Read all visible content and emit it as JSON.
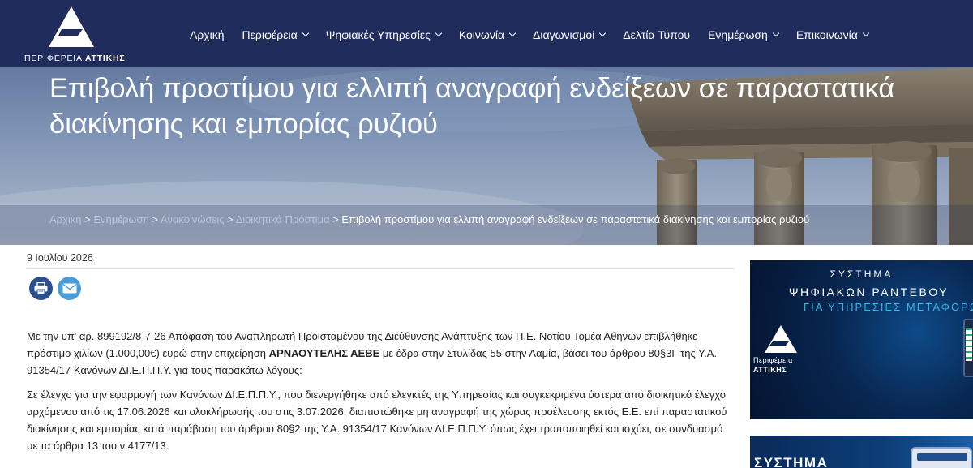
{
  "brand": {
    "logo_text_prefix": "ΠΕΡΙΦΕΡΕΙΑ ",
    "logo_text_bold": "ΑΤΤΙΚΗΣ"
  },
  "nav": {
    "items": [
      {
        "label": "Αρχική",
        "has_dropdown": false
      },
      {
        "label": "Περιφέρεια",
        "has_dropdown": true
      },
      {
        "label": "Ψηφιακές Υπηρεσίες",
        "has_dropdown": true
      },
      {
        "label": "Κοινωνία",
        "has_dropdown": true
      },
      {
        "label": "Διαγωνισμοί",
        "has_dropdown": true
      },
      {
        "label": "Δελτία Τύπου",
        "has_dropdown": false
      },
      {
        "label": "Ενημέρωση",
        "has_dropdown": true
      },
      {
        "label": "Επικοινωνία",
        "has_dropdown": true
      }
    ]
  },
  "hero": {
    "title": "Επιβολή προστίμου για ελλιπή αναγραφή ενδείξεων σε παραστατικά διακίνησης και εμπορίας ρυζιού"
  },
  "breadcrumb": {
    "home": "Αρχική",
    "news": "Ενημέρωση",
    "announcements": "Ανακοινώσεις",
    "fines": "Διοικητικά Πρόστιμα",
    "separator": " > ",
    "current": "Επιβολή προστίμου για ελλιπή αναγραφή ενδείξεων σε παραστατικά διακίνησης και εμπορίας ρυζιού"
  },
  "article": {
    "date": "9 Ιουλίου 2026",
    "p1_before": "Με την υπ' αρ. 899192/8-7-26 Απόφαση του Αναπληρωτή Προϊσταμένου της Διεύθυνσης Ανάπτυξης των Π.Ε. Νοτίου Τομέα Αθηνών επιβλήθηκε πρόστιμο χιλίων (1.000,00€) ευρώ στην επιχείρηση ",
    "p1_bold": "ΑΡΝΑΟΥΤΕΛΗΣ ΑΕΒΕ",
    "p1_after": " με έδρα στην Στυλίδας 55 στην Λαμία, βάσει του άρθρου 80§3Γ της Υ.Α. 91354/17 Κανόνων ΔΙ.Ε.Π.Π.Υ. για τους παρακάτω λόγους:",
    "p2": "Σε έλεγχο για την εφαρμογή των Κανόνων ΔΙ.Ε.Π.Π.Υ., που διενεργήθηκε από ελεγκτές της Υπηρεσίας και συγκεκριμένα ύστερα από διοικητικό έλεγχο αρχόμενου από τις 17.06.2026 και ολοκλήρωσής του στις 3.07.2026, διαπιστώθηκε μη αναγραφή της χώρας προέλευσης εκτός Ε.Ε. επί παραστατικού διακίνησης και εμπορίας κατά παράβαση του άρθρου 80§2 της Υ.Α. 91354/17 Κανόνων ΔΙ.Ε.Π.Π.Υ. όπως έχει τροποποιηθεί και ισχύει, σε συνδυασμό με τα άρθρα 13 του ν.4177/13."
  },
  "share": {
    "print_icon": "print-icon",
    "email_icon": "email-icon"
  },
  "sidebar": {
    "ad1": {
      "line1": "ΣΥΣΤΗΜΑ",
      "line2": "ΨΗΦΙΑΚΩΝ ΡΑΝΤΕΒΟΥ",
      "line3": "ΓΙΑ ΥΠΗΡΕΣΙΕΣ ΜΕΤΑΦΟΡΩΝ",
      "logo_line1": "Περιφέρεια",
      "logo_line2": "ΑΤΤΙΚΗΣ"
    },
    "ad2": {
      "line1": "ΣΥΣΤΗΜΑ"
    }
  },
  "colors": {
    "header_bg": "#1f2c5c",
    "breadcrumb_link": "#b9c4d8",
    "print_button": "#2b4f8f",
    "email_button": "#4a9bd8",
    "ad_accent": "#36b3e8"
  }
}
